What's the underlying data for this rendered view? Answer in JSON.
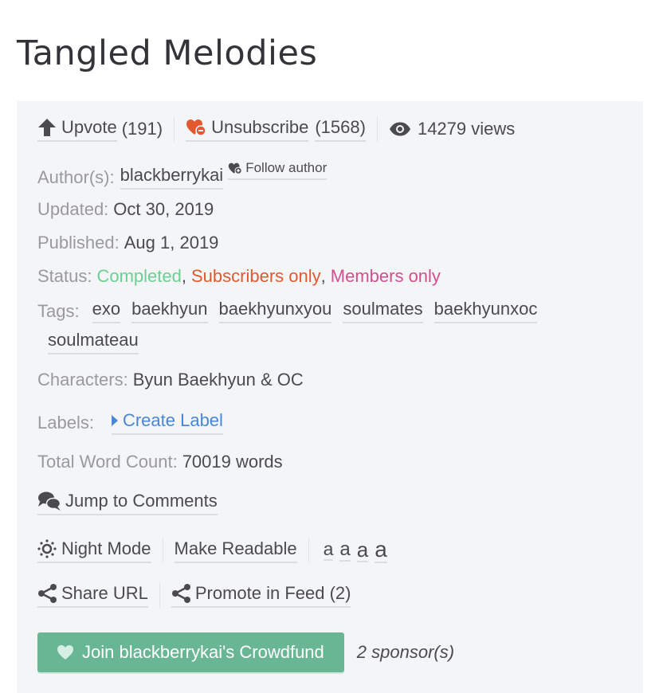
{
  "story": {
    "title": "Tangled Melodies"
  },
  "actions": {
    "upvote_label": "Upvote",
    "upvote_count": "(191)",
    "unsubscribe_label": "Unsubscribe",
    "subscriber_count": "(1568)",
    "views": "14279 views"
  },
  "meta": {
    "author_label": "Author(s):",
    "author": "blackberrykai",
    "follow_author": "Follow author",
    "updated_label": "Updated:",
    "updated": "Oct 30, 2019",
    "published_label": "Published:",
    "published": "Aug 1, 2019",
    "status_label": "Status:",
    "status": [
      {
        "text": "Completed",
        "color": "#6ccf93"
      },
      {
        "text": "Subscribers only",
        "color": "#e2582f"
      },
      {
        "text": "Members only",
        "color": "#cf4f8f"
      }
    ],
    "status_sep": ",",
    "tags_label": "Tags:",
    "tags": [
      "exo",
      "baekhyun",
      "baekhyunxyou",
      "soulmates",
      "baekhyunxoc",
      "soulmateau"
    ],
    "characters_label": "Characters:",
    "characters": "Byun Baekhyun & OC",
    "labels_label": "Labels:",
    "create_label": "Create Label",
    "word_count_label": "Total Word Count:",
    "word_count": "70019 words"
  },
  "reading": {
    "jump_to_comments": "Jump to Comments",
    "night_mode": "Night Mode",
    "make_readable": "Make Readable",
    "font_sizes": [
      "a",
      "a",
      "a",
      "a"
    ],
    "share_url": "Share URL",
    "promote": "Promote in Feed (2)"
  },
  "crowdfund": {
    "button": "Join blackberrykai's Crowdfund",
    "sponsors": "2 sponsor(s)"
  },
  "colors": {
    "accent_green": "#69b695",
    "link_blue": "#4a86d8",
    "subscribe_orange": "#e2582f",
    "panel_bg": "#f4f5f7"
  }
}
